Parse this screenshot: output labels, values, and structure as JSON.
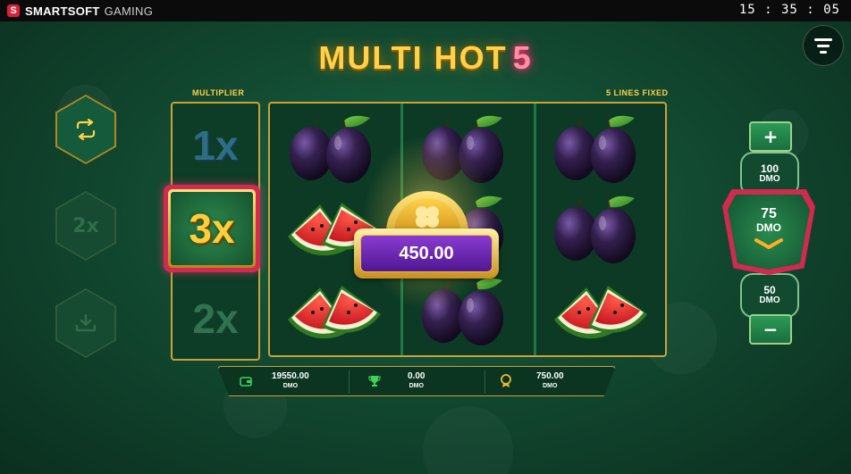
{
  "topbar": {
    "brand": "SMARTSOFT",
    "brand_sub": "GAMING",
    "clock": "15 : 35 : 05"
  },
  "title": {
    "main": "MULTI HOT",
    "number": "5"
  },
  "labels": {
    "multiplier": "MULTIPLIER",
    "lines": "5 LINES FIXED"
  },
  "left_controls": {
    "x2_label": "2x"
  },
  "multipliers": [
    "1x",
    "3x",
    "2x"
  ],
  "active_multiplier": "3x",
  "reels": [
    [
      "plum",
      "watermelon",
      "watermelon"
    ],
    [
      "plum",
      "plum",
      "plum"
    ],
    [
      "plum",
      "plum",
      "watermelon"
    ]
  ],
  "win": {
    "amount": "450.00"
  },
  "info": {
    "balance": {
      "value": "19550.00",
      "unit": "DMO"
    },
    "win": {
      "value": "0.00",
      "unit": "DMO"
    },
    "bonus": {
      "value": "750.00",
      "unit": "DMO"
    }
  },
  "bet": {
    "plus": "+",
    "minus": "−",
    "upper": {
      "value": "100",
      "unit": "DMO"
    },
    "selected": {
      "value": "75",
      "unit": "DMO"
    },
    "lower": {
      "value": "50",
      "unit": "DMO"
    }
  },
  "colors": {
    "gold": "#ffd24a",
    "accent_red": "#d2294f",
    "bg_green": "#124a31",
    "win_purple": "#6a26b3"
  }
}
